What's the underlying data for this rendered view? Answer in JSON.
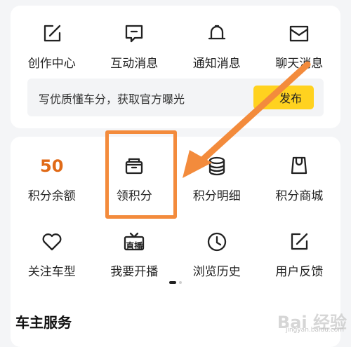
{
  "row1": [
    {
      "label": "创作中心",
      "icon": "edit-square-icon"
    },
    {
      "label": "互动消息",
      "icon": "chat-bubble-icon"
    },
    {
      "label": "通知消息",
      "icon": "bell-icon"
    },
    {
      "label": "聊天消息",
      "icon": "envelope-icon"
    }
  ],
  "banner": {
    "text": "写优质懂车分，获取官方曝光",
    "button": "发布",
    "button_icon": "pen-icon"
  },
  "row2": [
    {
      "value": "50",
      "label": "积分余额"
    },
    {
      "label": "领积分",
      "icon": "gift-box-icon"
    },
    {
      "label": "积分明细",
      "icon": "coin-stack-icon"
    },
    {
      "label": "积分商城",
      "icon": "shopping-bag-icon"
    }
  ],
  "row3": [
    {
      "label": "关注车型",
      "icon": "heart-icon"
    },
    {
      "label": "我要开播",
      "icon": "live-tv-icon",
      "icon_text": "直播"
    },
    {
      "label": "浏览历史",
      "icon": "clock-icon"
    },
    {
      "label": "用户反馈",
      "icon": "edit-square-icon"
    }
  ],
  "section": {
    "title": "车主服务"
  },
  "watermark": {
    "main": "Bai 经验",
    "sub": "jingyan.baidu.com"
  },
  "colors": {
    "accent": "#ffd21f",
    "points": "#e06a17",
    "annotation": "#f38b3c"
  }
}
